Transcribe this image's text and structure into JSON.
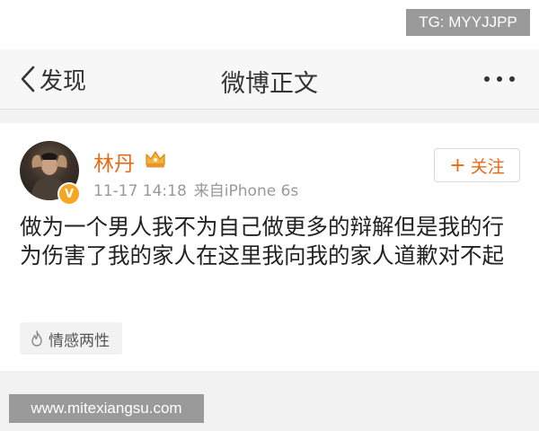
{
  "overlay": {
    "tg_label": "TG: MYYJJPP",
    "watermark": "www.mitexiangsu.com"
  },
  "navbar": {
    "back_label": "发现",
    "title": "微博正文",
    "more_icon": "more-dots-icon"
  },
  "post": {
    "user_name": "林丹",
    "verified_badge": "V",
    "verified_color": "#f5a623",
    "crown_icon": "crown-icon",
    "time": "11-17 14:18",
    "source": "来自iPhone 6s",
    "follow": {
      "plus": "+",
      "label": "关注"
    },
    "text": "做为一个男人我不为自己做更多的辩解但是我的行为伤害了我的家人在这里我向我的家人道歉对不起",
    "tag": "情感两性",
    "tag_icon": "flame-icon"
  },
  "colors": {
    "accent": "#e86a18",
    "navbar_bg": "#f7f7f7",
    "muted_text": "#999999",
    "overlay_bg": "#9a9a9a"
  }
}
